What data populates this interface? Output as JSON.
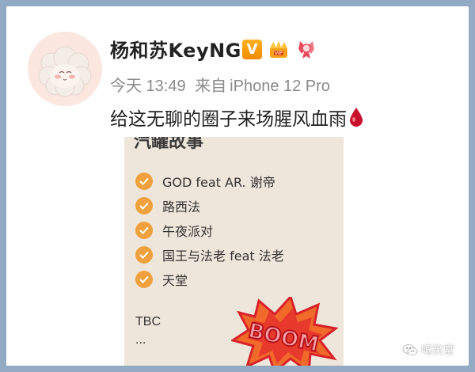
{
  "post": {
    "username": "杨和苏KeyNG",
    "badges": {
      "verified": "V"
    },
    "meta": {
      "time": "今天 13:49",
      "source_prefix": "来自",
      "device": "iPhone 12 Pro"
    },
    "text": "给这无聊的圈子来场腥风血雨",
    "emoji_icon": "blood-drop-icon"
  },
  "image": {
    "title_partial": "汽罐故事",
    "songs": [
      {
        "label": "GOD feat AR. 谢帝"
      },
      {
        "label": "路西法"
      },
      {
        "label": "午夜派对"
      },
      {
        "label": "国王与法老 feat 法老"
      },
      {
        "label": "天堂"
      }
    ],
    "tbc": "TBC",
    "ellipsis": "...",
    "boom_text": "BOOM"
  },
  "watermark": {
    "label": "嘻笑堂"
  },
  "colors": {
    "background": "#93aac4",
    "check": "#f0a13d",
    "boom_red": "#d8222a",
    "boom_orange": "#f26a2a",
    "verified": "#f5a000"
  }
}
